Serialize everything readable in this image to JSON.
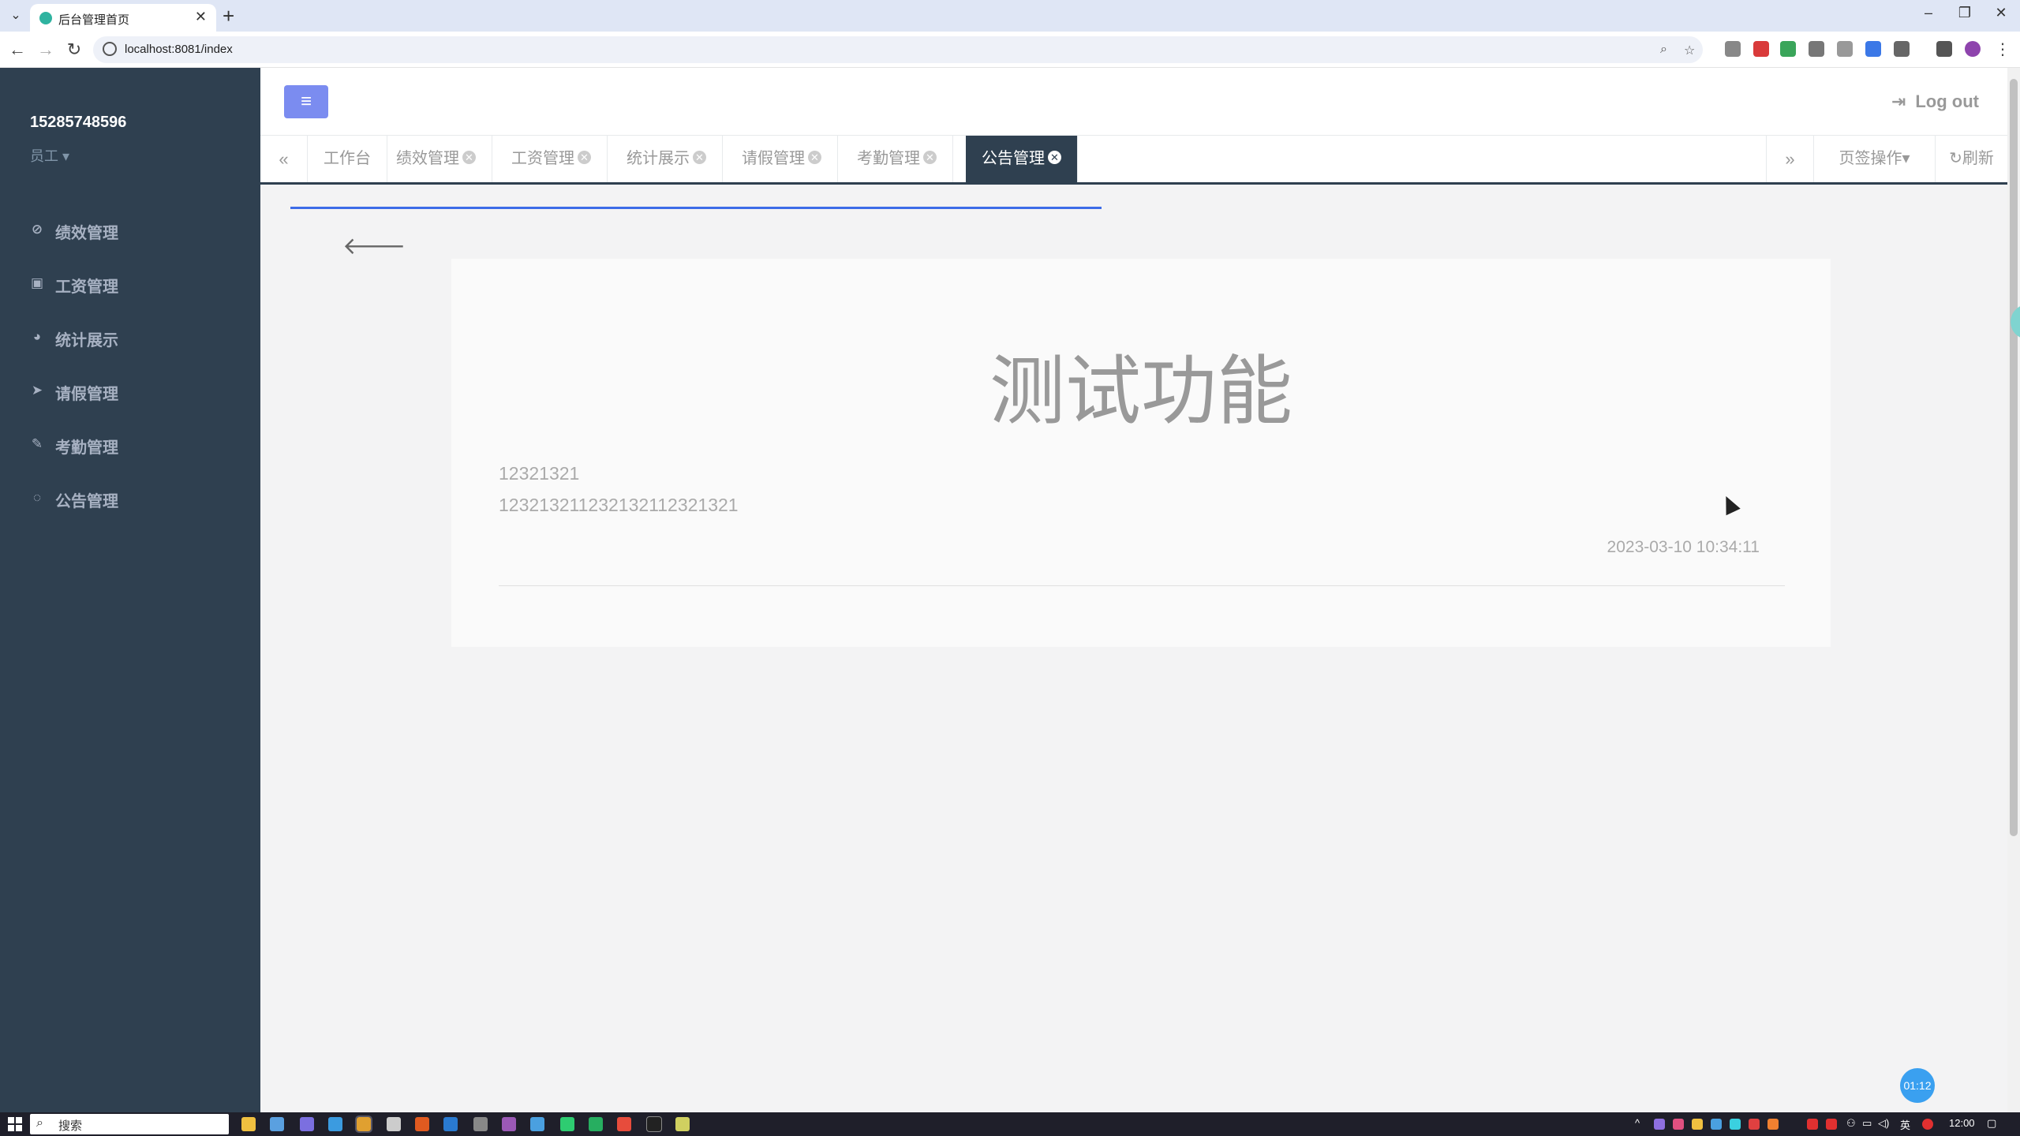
{
  "browser": {
    "tab_title": "后台管理首页",
    "url": "localhost:8081/index",
    "new_tab": "+",
    "tab_close": "✕"
  },
  "sidebar": {
    "user_phone": "15285748596",
    "user_role": "员工",
    "items": [
      {
        "label": "绩效管理",
        "icon": "check-circle-icon"
      },
      {
        "label": "工资管理",
        "icon": "money-icon"
      },
      {
        "label": "统计展示",
        "icon": "pie-chart-icon"
      },
      {
        "label": "请假管理",
        "icon": "paper-plane-icon"
      },
      {
        "label": "考勤管理",
        "icon": "edit-icon"
      },
      {
        "label": "公告管理",
        "icon": "comment-icon"
      }
    ]
  },
  "topnav": {
    "logout_label": "Log out"
  },
  "tabs": {
    "items": [
      {
        "label": "工作台"
      },
      {
        "label": "绩效管理"
      },
      {
        "label": "工资管理"
      },
      {
        "label": "统计展示"
      },
      {
        "label": "请假管理"
      },
      {
        "label": "考勤管理"
      },
      {
        "label": "公告管理",
        "active": true
      }
    ],
    "ops_label": "页签操作",
    "refresh_label": "刷新"
  },
  "notice": {
    "title": "测试功能",
    "line1": "12321321",
    "line2": "123213211232132112321321",
    "timestamp": "2023-03-10 10:34:11"
  },
  "widget": {
    "timer": "01:12"
  },
  "taskbar": {
    "search_label": "搜索",
    "ime": "英",
    "clock": "12:00"
  },
  "colors": {
    "sidebar_bg": "#2f4050",
    "accent": "#7b8cf0",
    "progress": "#3c6ce8"
  }
}
